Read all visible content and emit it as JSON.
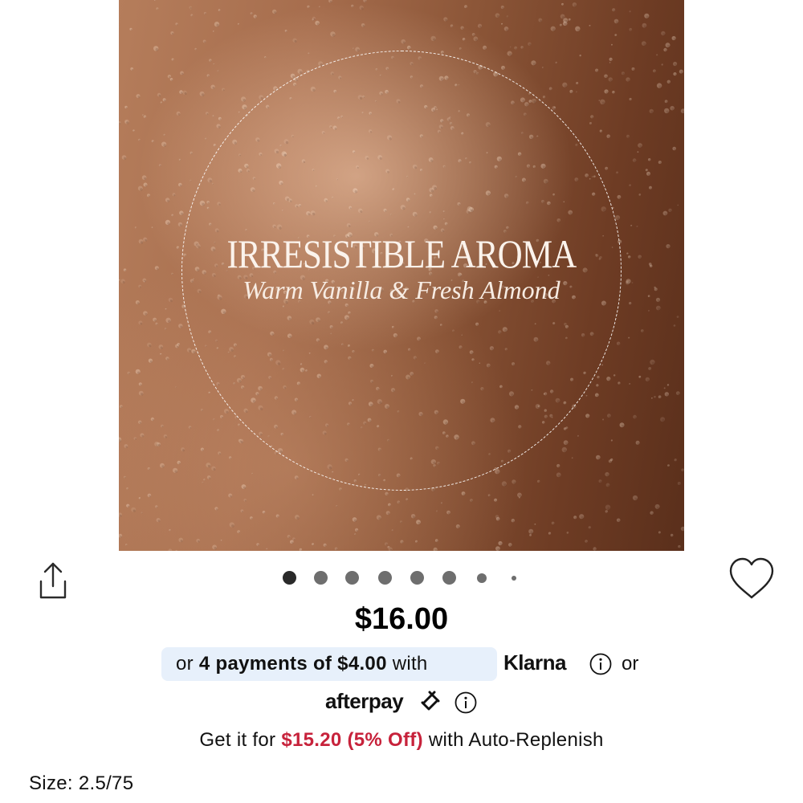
{
  "hero": {
    "title": "IRRESISTIBLE AROMA",
    "subtitle": "Warm Vanilla & Fresh Almond"
  },
  "carousel": {
    "total": 8,
    "active_index": 0
  },
  "icons": {
    "share": "share-icon",
    "heart": "heart-icon",
    "info": "info-icon",
    "afterpay_arrows": "afterpay-arrows-icon"
  },
  "price": "$16.00",
  "klarna": {
    "prefix": "or ",
    "installments": "4 payments of $4.00",
    "suffix": " with",
    "brand": "Klarna",
    "or_label": "or"
  },
  "afterpay": {
    "brand": "afterpay"
  },
  "auto_replenish": {
    "prefix": "Get it for ",
    "sale_price": "$15.20 (5% Off)",
    "suffix": " with Auto-Replenish"
  },
  "size": {
    "label": "Size: 2.5/75"
  },
  "colors": {
    "sale": "#c7223b",
    "klarna_pill": "#e7f0fb",
    "dot": "#6e6e6e"
  }
}
